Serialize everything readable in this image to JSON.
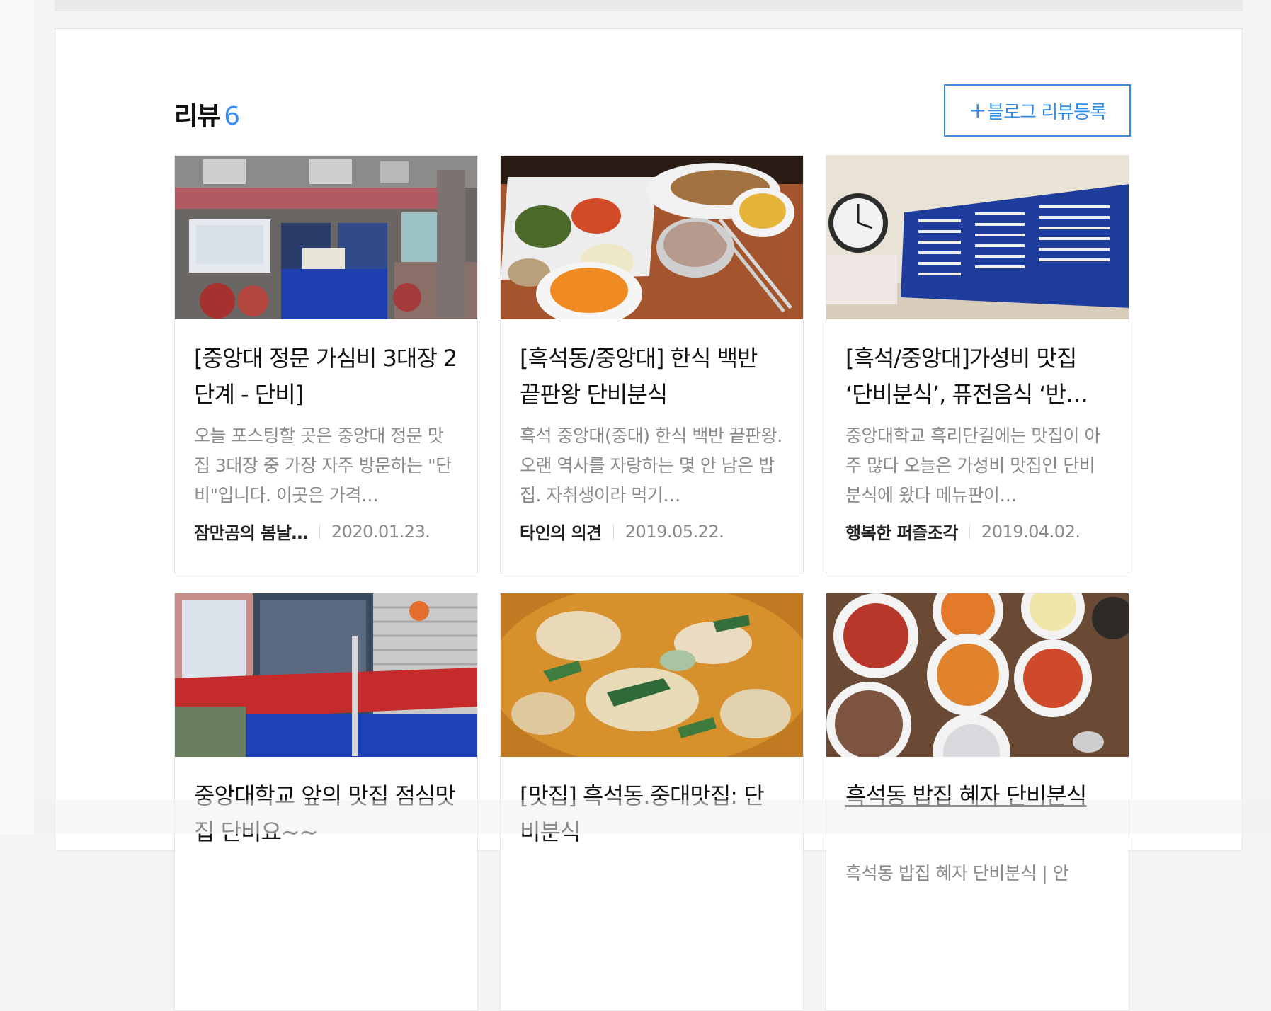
{
  "reviews": {
    "title": "리뷰",
    "count": "6",
    "register_button": {
      "plus": "+",
      "label": "블로그 리뷰등록"
    },
    "cards": [
      {
        "title": "[중앙대 정문 가심비 3대장 2단계 - 단비]",
        "desc": "오늘 포스팅할 곳은 중앙대 정문 맛집 3대장 중 가장 자주 방문하는 \"단비\"입니다. 이곳은 가격…",
        "author": "잠만곰의 봄날…",
        "date": "2020.01.23.",
        "image": "storefront-photo"
      },
      {
        "title": "[흑석동/중앙대] 한식 백반 끝판왕 단비분식",
        "desc": "흑석 중앙대(중대) 한식 백반 끝판왕. 오랜 역사를 자랑하는 몇 안 남은 밥집. 자취생이라 먹기…",
        "author": "타인의 의견",
        "date": "2019.05.22.",
        "image": "meal-tray-photo"
      },
      {
        "title": "[흑석/중앙대]가성비 맛집 ‘단비분식’, 퓨전음식 ‘반…",
        "desc": "중앙대학교 흑리단길에는 맛집이 아주 많다 오늘은 가성비 맛집인 단비 분식에 왔다 메뉴판이…",
        "author": "행복한 퍼즐조각",
        "date": "2019.04.02.",
        "image": "menu-board-photo"
      },
      {
        "title": "중앙대학교 앞의 맛집 점심맛집 단비요~~",
        "desc": "",
        "author": "",
        "date": "",
        "image": "entrance-photo"
      },
      {
        "title": "[맛집] 흑석동.중대맛집: 단비분식",
        "desc": "",
        "author": "",
        "date": "",
        "image": "stew-photo"
      },
      {
        "title": "흑석동 밥집 혜자 단비분식",
        "desc": "흑석동 밥집 혜자 단비분식 | 안",
        "author": "",
        "date": "",
        "image": "side-dishes-photo"
      }
    ]
  }
}
